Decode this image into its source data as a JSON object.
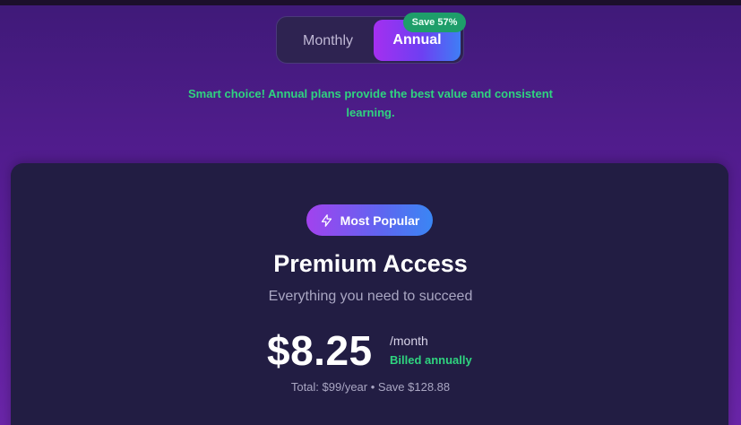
{
  "billing_toggle": {
    "monthly_label": "Monthly",
    "annual_label": "Annual",
    "selected": "Annual",
    "save_badge": "Save 57%"
  },
  "smart_message": "Smart choice! Annual plans provide the best value and consistent learning.",
  "plan": {
    "badge_icon": "lightning-icon",
    "badge_label": "Most Popular",
    "title": "Premium Access",
    "subtitle": "Everything you need to succeed",
    "price": "$8.25",
    "period": "/month",
    "billing_note": "Billed annually",
    "total_line": "Total: $99/year • Save $128.88"
  },
  "colors": {
    "accent_green": "#2fd47f",
    "card_bg": "#221d43",
    "gradient_start": "#a52ff0",
    "gradient_end": "#3f7ef5"
  }
}
